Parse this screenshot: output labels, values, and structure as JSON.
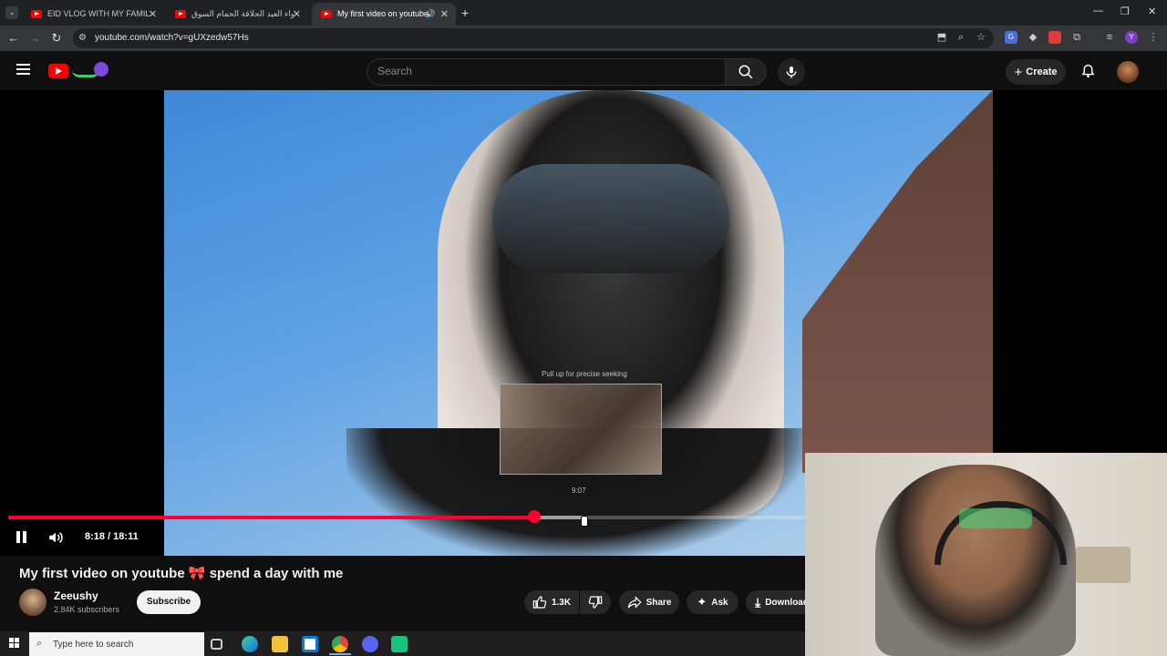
{
  "browser": {
    "tabs": [
      {
        "title": "EID VLOG WITH MY FAMILY I 😊"
      },
      {
        "title": "اجواء العيد الحلاقة الحمام السوق"
      },
      {
        "title": "My first video on youtube 🎀"
      }
    ],
    "url": "youtube.com/watch?v=gUXzedw57Hs",
    "new_tab": "+"
  },
  "youtube": {
    "search_placeholder": "Search",
    "create_label": "Create",
    "video": {
      "seek_hint": "Pull up for precise seeking",
      "preview_time": "9:07",
      "current_time": "8:18",
      "duration": "18:11",
      "time_text": "8:18 / 18:11",
      "progress_fraction": 0.457
    },
    "title": "My first video on youtube 🎀 spend a day with me",
    "channel": {
      "name": "Zeeushy",
      "subscribers": "2.84K subscribers",
      "subscribe_label": "Subscribe"
    },
    "actions": {
      "likes": "1.3K",
      "share": "Share",
      "ask": "Ask",
      "download": "Download"
    }
  },
  "taskbar": {
    "search_placeholder": "Type here to search"
  },
  "colors": {
    "accent": "#ff0033",
    "background": "#0f0f0f"
  }
}
